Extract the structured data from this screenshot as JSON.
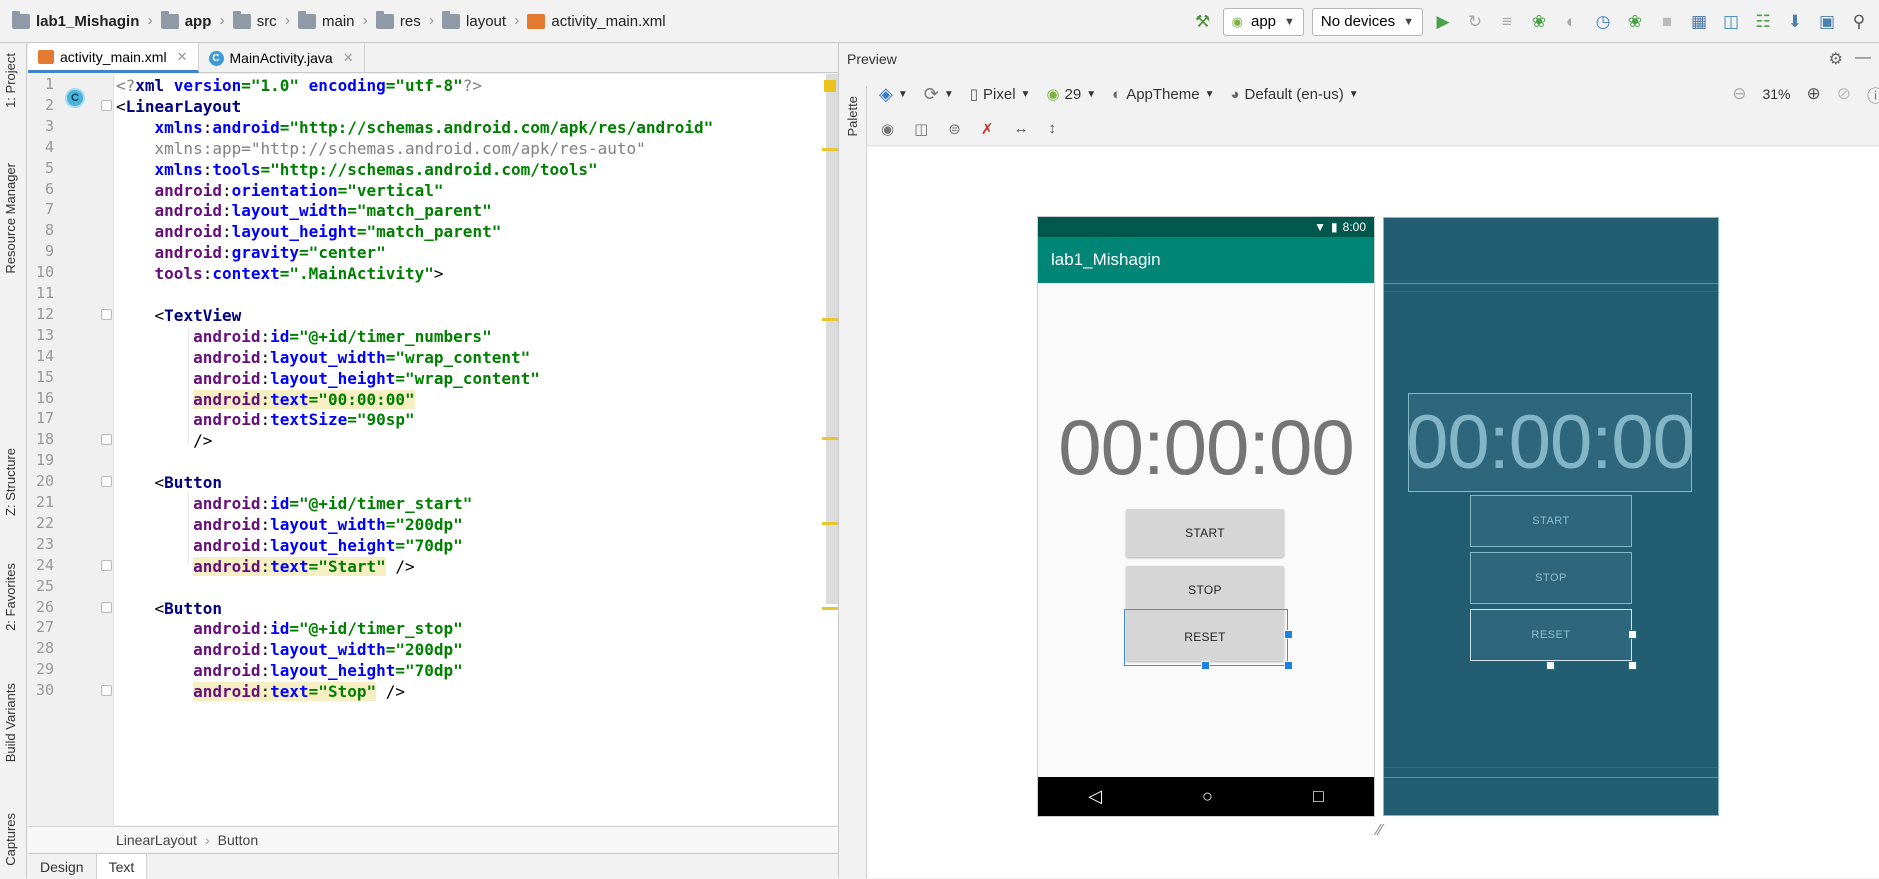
{
  "breadcrumbs": [
    {
      "label": "lab1_Mishagin",
      "bold": true,
      "icon": "project-folder-icon"
    },
    {
      "label": "app",
      "bold": true,
      "icon": "module-folder-icon"
    },
    {
      "label": "src",
      "bold": false,
      "icon": "folder-icon"
    },
    {
      "label": "main",
      "bold": false,
      "icon": "folder-icon"
    },
    {
      "label": "res",
      "bold": false,
      "icon": "res-folder-icon"
    },
    {
      "label": "layout",
      "bold": false,
      "icon": "folder-icon"
    },
    {
      "label": "activity_main.xml",
      "bold": false,
      "icon": "xml-file-icon"
    }
  ],
  "toolbar": {
    "run_config": "app",
    "device": "No devices"
  },
  "side_tabs": {
    "project": "1: Project",
    "resource_manager": "Resource Manager",
    "structure": "Z: Structure",
    "favorites": "2: Favorites",
    "build_variants": "Build Variants",
    "captures": "Captures"
  },
  "editor_tabs": [
    {
      "label": "activity_main.xml",
      "active": true
    },
    {
      "label": "MainActivity.java",
      "active": false
    }
  ],
  "code_lines": [
    {
      "n": "1",
      "html": "<span class='t-gray'>&lt;?</span><span class='t-tag'>xml </span><span class='t-attr'>version</span><span class='t-val'>=\"1.0\" </span><span class='t-attr'>encoding</span><span class='t-val'>=\"utf-8\"</span><span class='t-gray'>?&gt;</span>"
    },
    {
      "n": "2",
      "html": "<span class='t-plain'>&lt;</span><span class='t-tag'>LinearLayout</span>"
    },
    {
      "n": "3",
      "html": "    <span class='t-attr'>xmlns</span><span class='t-plain'>:</span><span class='t-attr'>android</span><span class='t-val'>=\"http://schemas.android.com/apk/res/android\"</span>"
    },
    {
      "n": "4",
      "html": "    <span class='t-gray'>xmlns:app=\"http://schemas.android.com/apk/res-auto\"</span>"
    },
    {
      "n": "5",
      "html": "    <span class='t-attr'>xmlns</span><span class='t-plain'>:</span><span class='t-attr'>tools</span><span class='t-val'>=\"http://schemas.android.com/tools\"</span>"
    },
    {
      "n": "6",
      "html": "    <span class='t-ns'>android</span><span class='t-plain'>:</span><span class='t-attr'>orientation</span><span class='t-val'>=\"vertical\"</span>"
    },
    {
      "n": "7",
      "html": "    <span class='t-ns'>android</span><span class='t-plain'>:</span><span class='t-attr'>layout_width</span><span class='t-val'>=\"match_parent\"</span>"
    },
    {
      "n": "8",
      "html": "    <span class='t-ns'>android</span><span class='t-plain'>:</span><span class='t-attr'>layout_height</span><span class='t-val'>=\"match_parent\"</span>"
    },
    {
      "n": "9",
      "html": "    <span class='t-ns'>android</span><span class='t-plain'>:</span><span class='t-attr'>gravity</span><span class='t-val'>=\"center\"</span>"
    },
    {
      "n": "10",
      "html": "    <span class='t-ns'>tools</span><span class='t-plain'>:</span><span class='t-attr'>context</span><span class='t-val'>=\".MainActivity\"</span><span class='t-plain'>&gt;</span>"
    },
    {
      "n": "11",
      "html": ""
    },
    {
      "n": "12",
      "html": "    <span class='t-plain'>&lt;</span><span class='t-tag'>TextView</span>"
    },
    {
      "n": "13",
      "html": "        <span class='t-ns'>android</span><span class='t-plain'>:</span><span class='t-attr'>id</span><span class='t-val'>=\"@+id/timer_numbers\"</span>"
    },
    {
      "n": "14",
      "html": "        <span class='t-ns'>android</span><span class='t-plain'>:</span><span class='t-attr'>layout_width</span><span class='t-val'>=\"wrap_content\"</span>"
    },
    {
      "n": "15",
      "html": "        <span class='t-ns'>android</span><span class='t-plain'>:</span><span class='t-attr'>layout_height</span><span class='t-val'>=\"wrap_content\"</span>"
    },
    {
      "n": "16",
      "html": "        <span class='hl'><span class='t-ns'>android</span><span class='t-plain'>:</span><span class='t-attr'>text</span><span class='t-val'>=\"00:00:00\"</span></span>"
    },
    {
      "n": "17",
      "html": "        <span class='t-ns'>android</span><span class='t-plain'>:</span><span class='t-attr'>textSize</span><span class='t-val'>=\"90sp\"</span>"
    },
    {
      "n": "18",
      "html": "        <span class='t-plain'>/&gt;</span>"
    },
    {
      "n": "19",
      "html": ""
    },
    {
      "n": "20",
      "html": "    <span class='t-plain'>&lt;</span><span class='t-tag'>Button</span>"
    },
    {
      "n": "21",
      "html": "        <span class='t-ns'>android</span><span class='t-plain'>:</span><span class='t-attr'>id</span><span class='t-val'>=\"@+id/timer_start\"</span>"
    },
    {
      "n": "22",
      "html": "        <span class='t-ns'>android</span><span class='t-plain'>:</span><span class='t-attr'>layout_width</span><span class='t-val'>=\"200dp\"</span>"
    },
    {
      "n": "23",
      "html": "        <span class='t-ns'>android</span><span class='t-plain'>:</span><span class='t-attr'>layout_height</span><span class='t-val'>=\"70dp\"</span>"
    },
    {
      "n": "24",
      "html": "        <span class='hl'><span class='t-ns'>android</span><span class='t-plain'>:</span><span class='t-attr'>text</span><span class='t-val'>=\"Start\"</span></span> <span class='t-plain'>/&gt;</span>"
    },
    {
      "n": "25",
      "html": ""
    },
    {
      "n": "26",
      "html": "    <span class='t-plain'>&lt;</span><span class='t-tag'>Button</span>"
    },
    {
      "n": "27",
      "html": "        <span class='t-ns'>android</span><span class='t-plain'>:</span><span class='t-attr'>id</span><span class='t-val'>=\"@+id/timer_stop\"</span>"
    },
    {
      "n": "28",
      "html": "        <span class='t-ns'>android</span><span class='t-plain'>:</span><span class='t-attr'>layout_width</span><span class='t-val'>=\"200dp\"</span>"
    },
    {
      "n": "29",
      "html": "        <span class='t-ns'>android</span><span class='t-plain'>:</span><span class='t-attr'>layout_height</span><span class='t-val'>=\"70dp\"</span>"
    },
    {
      "n": "30",
      "html": "        <span class='hl'><span class='t-ns'>android</span><span class='t-plain'>:</span><span class='t-attr'>text</span><span class='t-val'>=\"Stop\"</span></span> <span class='t-plain'>/&gt;</span>"
    }
  ],
  "code_breadcrumb": [
    "LinearLayout",
    "Button"
  ],
  "bottom_tabs": [
    {
      "label": "Design",
      "active": false
    },
    {
      "label": "Text",
      "active": true
    }
  ],
  "preview": {
    "title": "Preview",
    "palette_label": "Palette",
    "device": "Pixel",
    "api": "29",
    "theme": "AppTheme",
    "locale": "Default (en-us)",
    "zoom": "31%"
  },
  "phone": {
    "time": "8:00",
    "app_title": "lab1_Mishagin",
    "timer_text": "00:00:00",
    "buttons": [
      "START",
      "STOP",
      "RESET"
    ]
  },
  "blueprint": {
    "timer_text": "00:00:00",
    "buttons": [
      "START",
      "STOP",
      "RESET"
    ]
  },
  "colors": {
    "accent": "#4083c9",
    "app_bar": "#008577",
    "status_bar": "#00574b",
    "blueprint_bg": "#235d71"
  }
}
